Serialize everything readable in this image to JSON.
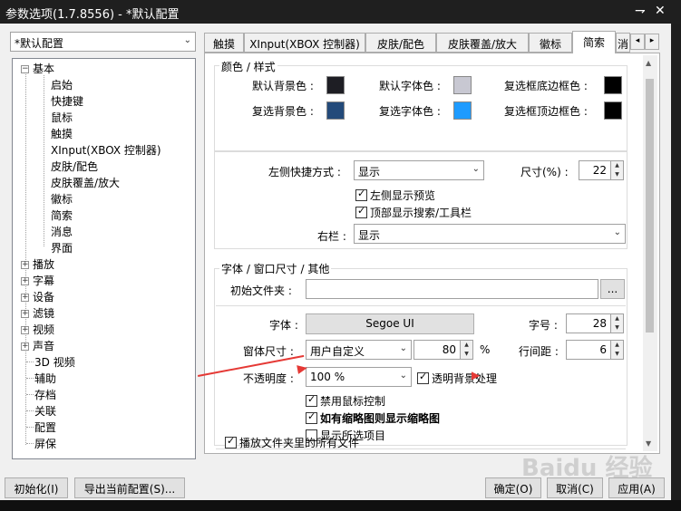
{
  "window": {
    "title": "参数选项(1.7.8556) - *默认配置",
    "pin_glyph": "⇁",
    "close_glyph": "✕"
  },
  "profile_combo": {
    "value": "*默认配置",
    "arrow": "⌄"
  },
  "tree": {
    "root": "基本",
    "children": [
      "启始",
      "快捷键",
      "鼠标",
      "触摸",
      "XInput(XBOX 控制器)",
      "皮肤/配色",
      "皮肤覆盖/放大",
      "徽标",
      "简索",
      "消息",
      "界面"
    ],
    "collapsed": [
      "播放",
      "字幕",
      "设备",
      "滤镜",
      "视频",
      "声音"
    ],
    "leaves": [
      "3D 视频",
      "辅助",
      "存档",
      "关联",
      "配置",
      "屏保"
    ],
    "expanded_glyph": "−",
    "collapsed_glyph": "+"
  },
  "tabs": {
    "items": [
      "触摸",
      "XInput(XBOX 控制器)",
      "皮肤/配色",
      "皮肤覆盖/放大",
      "徽标",
      "简索"
    ],
    "active": "简索",
    "overflow": "消",
    "scroll_left": "◂",
    "scroll_right": "▸"
  },
  "scrollbar": {
    "up": "▲",
    "down": "▼"
  },
  "colors_group": {
    "title": "颜色 / 样式",
    "items": [
      {
        "label": "默认背景色 :",
        "color": "#1e1e24"
      },
      {
        "label": "默认字体色 :",
        "color": "#c8c8d2"
      },
      {
        "label": "复选框底边框色 :",
        "color": "#000000"
      },
      {
        "label": "复选背景色 :",
        "color": "#234a7a"
      },
      {
        "label": "复选字体色 :",
        "color": "#1e9bff"
      },
      {
        "label": "复选框顶边框色 :",
        "color": "#000000"
      }
    ]
  },
  "shortcut": {
    "label": "左侧快捷方式 :",
    "value": "显示",
    "size_label": "尺寸(%) :",
    "size_value": "22",
    "show_preview": "左侧显示预览",
    "show_toolbar": "顶部显示搜索/工具栏",
    "right_label": "右栏 :",
    "right_value": "显示"
  },
  "font_group": {
    "title": "字体 / 窗口尺寸 / 其他",
    "folder_label": "初始文件夹 :",
    "folder_value": "",
    "browse": "...",
    "font_label": "字体 :",
    "font_value": "Segoe UI",
    "font_size_label": "字号 :",
    "font_size_value": "28",
    "window_size_label": "窗体尺寸 :",
    "window_size_value": "用户自定义",
    "window_size_pct": "80",
    "pct": "%",
    "line_spacing_label": "行间距 :",
    "line_spacing_value": "6",
    "opacity_label": "不透明度 :",
    "opacity_value": "100 %",
    "transparent_bg": "透明背景处理",
    "disable_mouse": "禁用鼠标控制",
    "show_thumbnail": "如有缩略图则显示缩略图",
    "show_selected": "显示所选项目",
    "play_all": "播放文件夹里的所有文件"
  },
  "buttons": {
    "init": "初始化(I)",
    "export": "导出当前配置(S)...",
    "ok": "确定(O)",
    "cancel": "取消(C)",
    "apply": "应用(A)"
  },
  "annotation": {
    "marker": "▶",
    "color": "#e53935"
  },
  "watermark": "Baidu 经验"
}
